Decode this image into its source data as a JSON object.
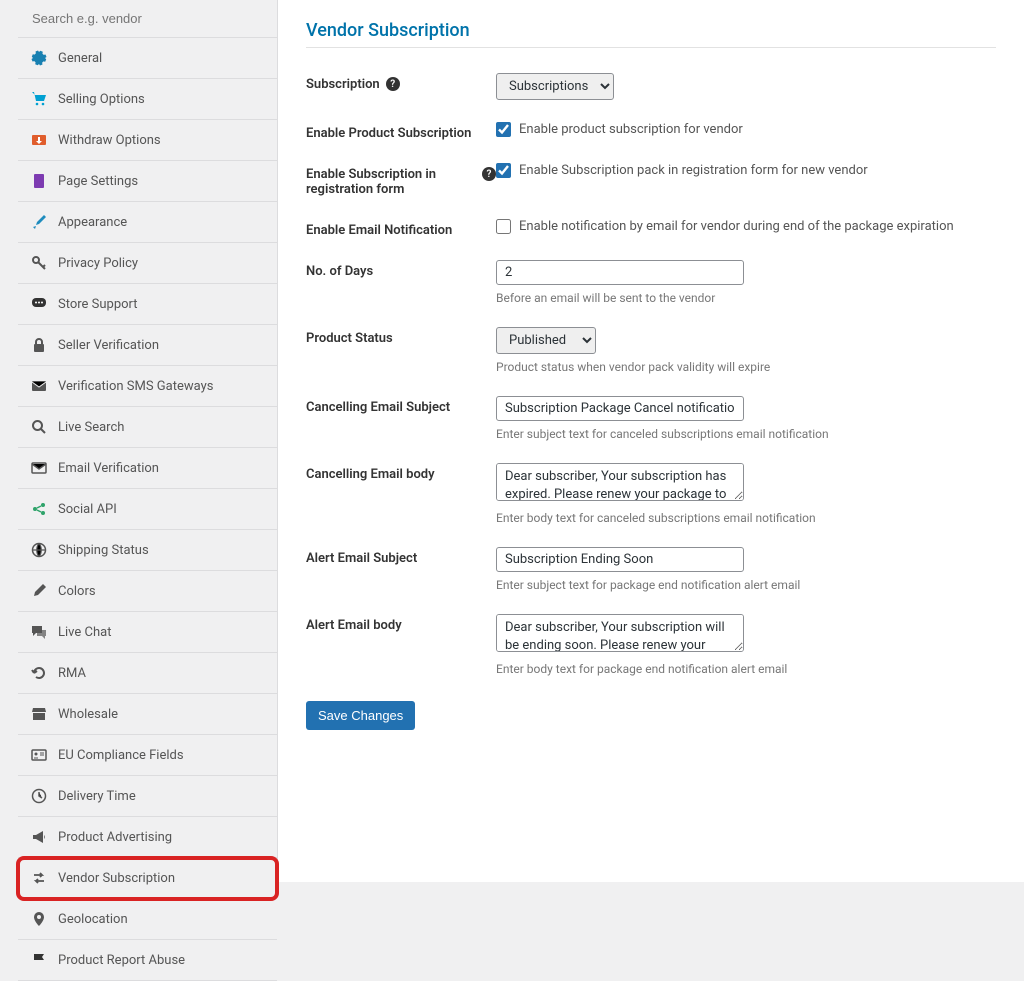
{
  "sidebar": {
    "search_placeholder": "Search e.g. vendor",
    "items": [
      {
        "label": "General",
        "icon": "gear-icon",
        "color": "#0073aa"
      },
      {
        "label": "Selling Options",
        "icon": "cart-icon",
        "color": "#00a0d2"
      },
      {
        "label": "Withdraw Options",
        "icon": "withdraw-icon",
        "color": "#e05d2c"
      },
      {
        "label": "Page Settings",
        "icon": "page-icon",
        "color": "#7d3bb1"
      },
      {
        "label": "Appearance",
        "icon": "brush-icon",
        "color": "#1e8cbe"
      },
      {
        "label": "Privacy Policy",
        "icon": "key-icon",
        "color": "#555"
      },
      {
        "label": "Store Support",
        "icon": "chat-icon",
        "color": "#333"
      },
      {
        "label": "Seller Verification",
        "icon": "lock-icon",
        "color": "#555"
      },
      {
        "label": "Verification SMS Gateways",
        "icon": "sms-icon",
        "color": "#555"
      },
      {
        "label": "Live Search",
        "icon": "search-icon",
        "color": "#555"
      },
      {
        "label": "Email Verification",
        "icon": "mail-icon",
        "color": "#555"
      },
      {
        "label": "Social API",
        "icon": "share-icon",
        "color": "#2ea36a"
      },
      {
        "label": "Shipping Status",
        "icon": "globe-icon",
        "color": "#555"
      },
      {
        "label": "Colors",
        "icon": "paint-icon",
        "color": "#555"
      },
      {
        "label": "Live Chat",
        "icon": "comments-icon",
        "color": "#555"
      },
      {
        "label": "RMA",
        "icon": "undo-icon",
        "color": "#555"
      },
      {
        "label": "Wholesale",
        "icon": "store-icon",
        "color": "#555"
      },
      {
        "label": "EU Compliance Fields",
        "icon": "id-icon",
        "color": "#555"
      },
      {
        "label": "Delivery Time",
        "icon": "clock-icon",
        "color": "#555"
      },
      {
        "label": "Product Advertising",
        "icon": "megaphone-icon",
        "color": "#555"
      },
      {
        "label": "Vendor Subscription",
        "icon": "retweet-icon",
        "color": "#555",
        "active": true
      },
      {
        "label": "Geolocation",
        "icon": "pin-icon",
        "color": "#555"
      },
      {
        "label": "Product Report Abuse",
        "icon": "flag-icon",
        "color": "#333"
      }
    ]
  },
  "title": "Vendor Subscription",
  "form": {
    "subscription": {
      "label": "Subscription",
      "value": "Subscriptions"
    },
    "enable_product_sub": {
      "label": "Enable Product Subscription",
      "checked": true,
      "desc": "Enable product subscription for vendor"
    },
    "enable_reg": {
      "label": "Enable Subscription in registration form",
      "checked": true,
      "desc": "Enable Subscription pack in registration form for new vendor"
    },
    "enable_email": {
      "label": "Enable Email Notification",
      "checked": false,
      "desc": "Enable notification by email for vendor during end of the package expiration"
    },
    "no_of_days": {
      "label": "No. of Days",
      "value": "2",
      "help": "Before an email will be sent to the vendor"
    },
    "product_status": {
      "label": "Product Status",
      "value": "Published",
      "help": "Product status when vendor pack validity will expire"
    },
    "cancel_subject": {
      "label": "Cancelling Email Subject",
      "value": "Subscription Package Cancel notification",
      "help": "Enter subject text for canceled subscriptions email notification"
    },
    "cancel_body": {
      "label": "Cancelling Email body",
      "value": "Dear subscriber, Your subscription has expired. Please renew your package to continue using it.",
      "help": "Enter body text for canceled subscriptions email notification"
    },
    "alert_subject": {
      "label": "Alert Email Subject",
      "value": "Subscription Ending Soon",
      "help": "Enter subject text for package end notification alert email"
    },
    "alert_body": {
      "label": "Alert Email body",
      "value": "Dear subscriber, Your subscription will be ending soon. Please renew your package in a timely",
      "help": "Enter body text for package end notification alert email"
    },
    "save": "Save Changes"
  }
}
